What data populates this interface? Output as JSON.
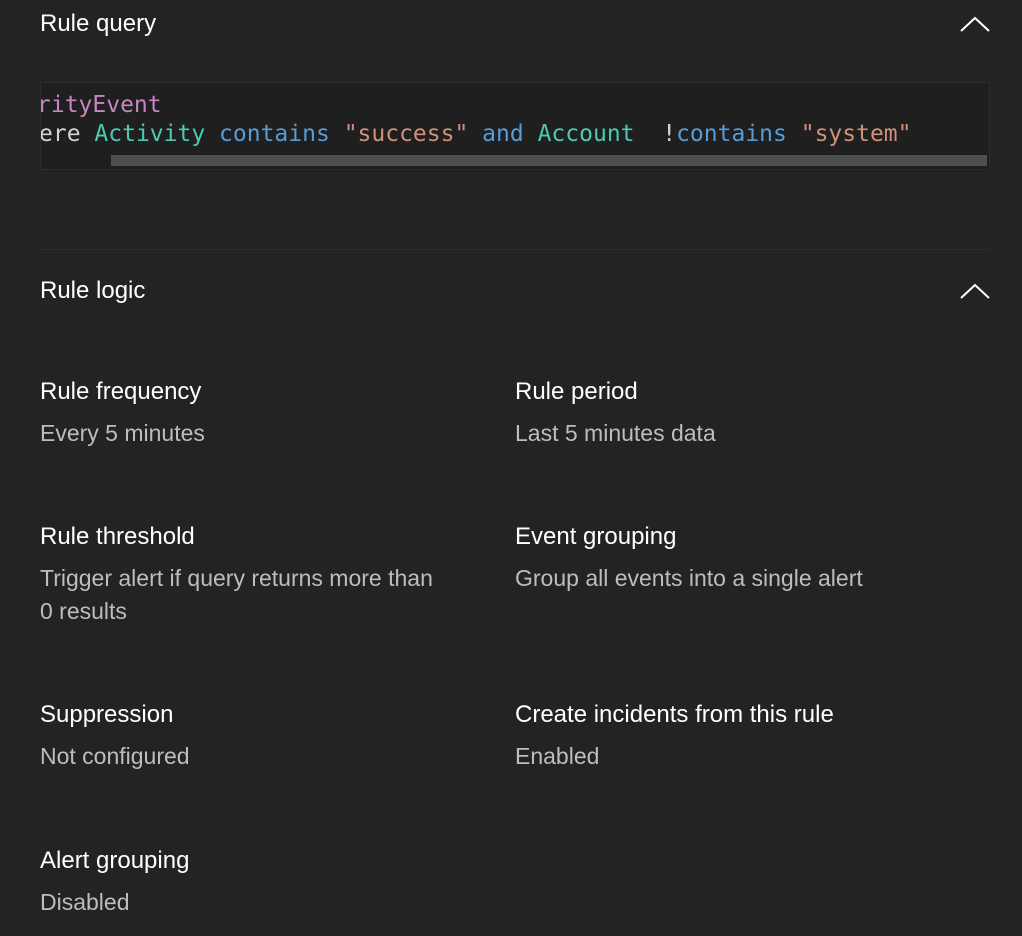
{
  "rule_query": {
    "title": "Rule query",
    "code": {
      "line1": {
        "table": "rityEvent"
      },
      "line2": {
        "keyword": "ere",
        "field1": "Activity",
        "op1": "contains",
        "string1": "\"success\"",
        "op2": "and",
        "field2": "Account",
        "bang": "!",
        "op3": "contains",
        "string2": "\"system\""
      }
    }
  },
  "rule_logic": {
    "title": "Rule logic",
    "fields": {
      "frequency": {
        "label": "Rule frequency",
        "value": "Every 5 minutes"
      },
      "period": {
        "label": "Rule period",
        "value": "Last 5 minutes data"
      },
      "threshold": {
        "label": "Rule threshold",
        "value": "Trigger alert if query returns more than 0 results"
      },
      "event_grouping": {
        "label": "Event grouping",
        "value": "Group all events into a single alert"
      },
      "suppression": {
        "label": "Suppression",
        "value": "Not configured"
      },
      "create_incidents": {
        "label": "Create incidents from this rule",
        "value": "Enabled"
      },
      "alert_grouping": {
        "label": "Alert grouping",
        "value": "Disabled"
      }
    }
  },
  "icons": {
    "collapse": "chevron-up-icon"
  },
  "colors": {
    "background": "#232323",
    "table_token": "#c586c0",
    "field_token": "#4ec9b0",
    "operator_token": "#569cd6",
    "string_token": "#ce9178"
  }
}
